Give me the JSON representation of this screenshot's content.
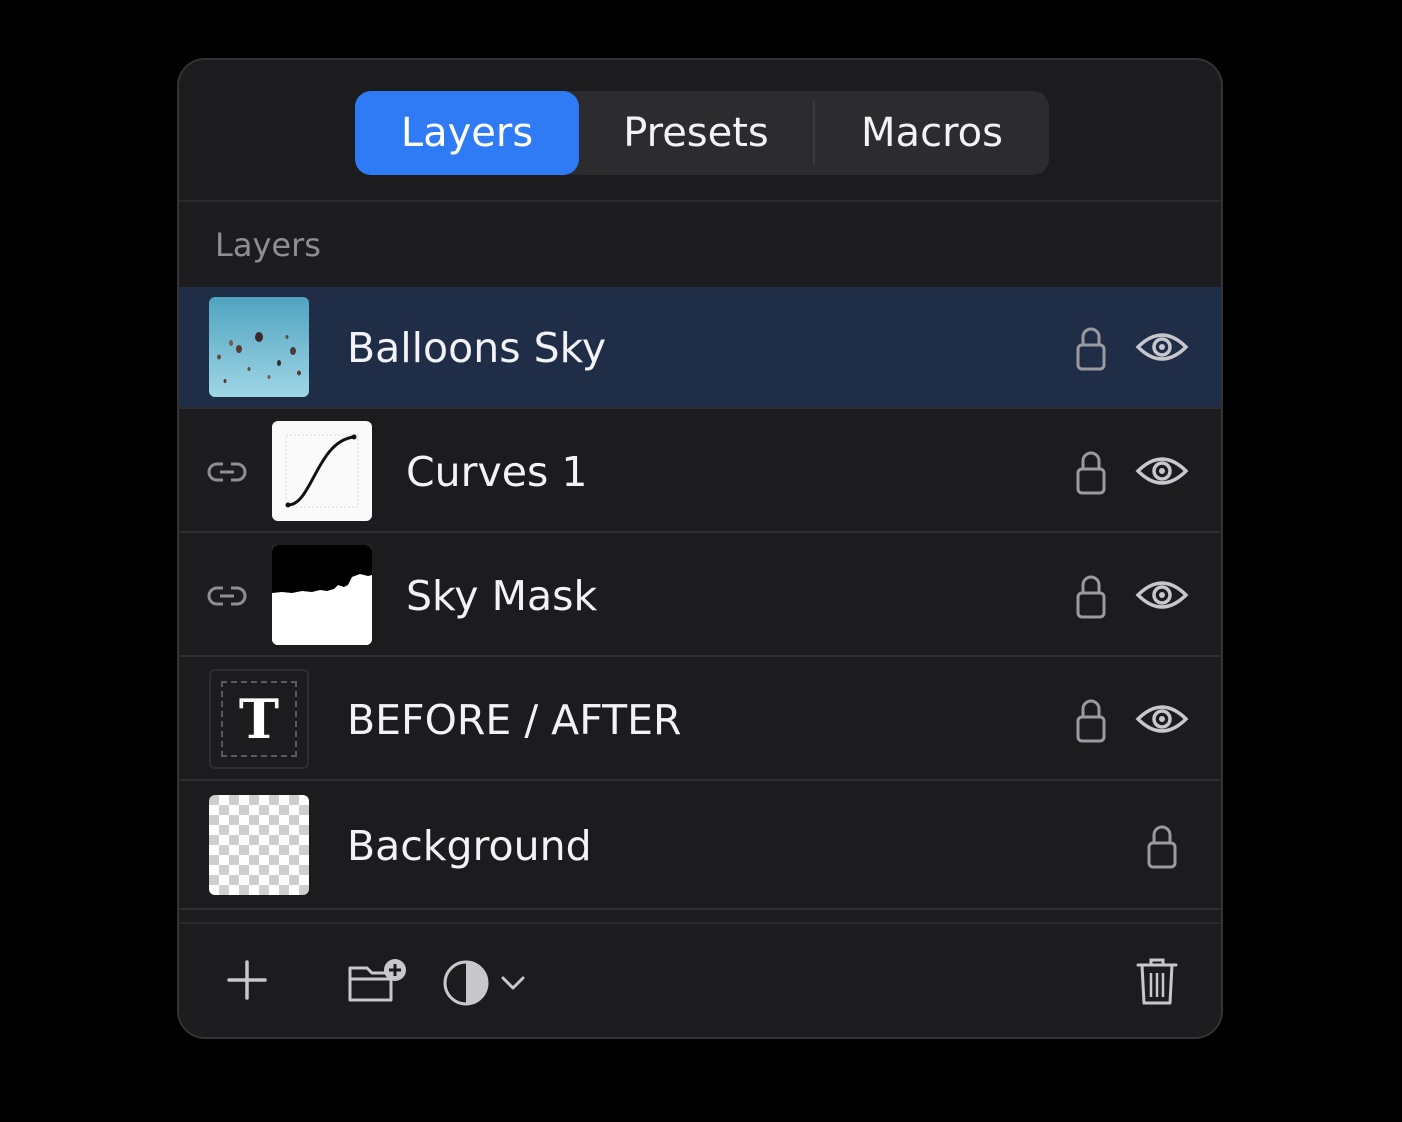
{
  "tabs": [
    {
      "label": "Layers",
      "active": true
    },
    {
      "label": "Presets",
      "active": false
    },
    {
      "label": "Macros",
      "active": false
    }
  ],
  "section": {
    "label": "Layers"
  },
  "layers": [
    {
      "name": "Balloons Sky",
      "thumbnail": "photo-balloons",
      "linked": false,
      "locked": false,
      "visible": true,
      "selected": true
    },
    {
      "name": "Curves 1",
      "thumbnail": "curves-adjustment",
      "linked": true,
      "locked": false,
      "visible": true,
      "selected": false
    },
    {
      "name": "Sky Mask",
      "thumbnail": "mask",
      "linked": true,
      "locked": false,
      "visible": true,
      "selected": false
    },
    {
      "name": "BEFORE / AFTER",
      "thumbnail": "text-layer",
      "text_glyph": "T",
      "linked": false,
      "locked": false,
      "visible": true,
      "selected": false
    },
    {
      "name": "Background",
      "thumbnail": "transparent-checkerboard",
      "linked": false,
      "locked": false,
      "visible": false,
      "selected": false
    }
  ],
  "footer": {
    "buttons": [
      {
        "icon": "plus-icon"
      },
      {
        "icon": "new-group-folder-icon"
      },
      {
        "icon": "adjustment-contrast-icon"
      },
      {
        "icon": "chevron-down-icon"
      },
      {
        "icon": "trash-icon"
      }
    ]
  },
  "colors": {
    "accent": "#2f7bf6",
    "selected_row": "#1f2d47",
    "panel": "#1c1c1e",
    "text": "#f2f2f7",
    "secondary_text": "#8e8e93"
  }
}
